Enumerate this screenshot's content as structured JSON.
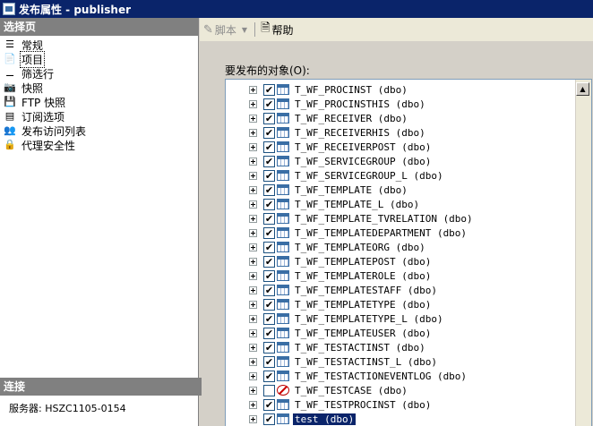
{
  "window": {
    "title": "发布属性 - publisher"
  },
  "left_pane": {
    "header": "选择页",
    "items": [
      {
        "label": "常规",
        "icon": "general-icon",
        "selected": false
      },
      {
        "label": "项目",
        "icon": "articles-icon",
        "selected": true
      },
      {
        "label": "筛选行",
        "icon": "filter-rows-icon",
        "selected": false
      },
      {
        "label": "快照",
        "icon": "snapshot-icon",
        "selected": false
      },
      {
        "label": "FTP 快照",
        "icon": "ftp-snapshot-icon",
        "selected": false
      },
      {
        "label": "订阅选项",
        "icon": "subscription-options-icon",
        "selected": false
      },
      {
        "label": "发布访问列表",
        "icon": "access-list-icon",
        "selected": false
      },
      {
        "label": "代理安全性",
        "icon": "agent-security-icon",
        "selected": false
      }
    ],
    "connection_header": "连接",
    "server_label": "服务器:",
    "server_value": "HSZC1105-0154"
  },
  "toolbar": {
    "script_label": "脚本",
    "help_label": "帮助"
  },
  "objects": {
    "label": "要发布的对象(O):",
    "rows": [
      {
        "name": "T_WF_PROCINST (dbo)",
        "checked": true,
        "blocked": false
      },
      {
        "name": "T_WF_PROCINSTHIS (dbo)",
        "checked": true,
        "blocked": false
      },
      {
        "name": "T_WF_RECEIVER (dbo)",
        "checked": true,
        "blocked": false
      },
      {
        "name": "T_WF_RECEIVERHIS (dbo)",
        "checked": true,
        "blocked": false
      },
      {
        "name": "T_WF_RECEIVERPOST (dbo)",
        "checked": true,
        "blocked": false
      },
      {
        "name": "T_WF_SERVICEGROUP (dbo)",
        "checked": true,
        "blocked": false
      },
      {
        "name": "T_WF_SERVICEGROUP_L (dbo)",
        "checked": true,
        "blocked": false
      },
      {
        "name": "T_WF_TEMPLATE (dbo)",
        "checked": true,
        "blocked": false
      },
      {
        "name": "T_WF_TEMPLATE_L (dbo)",
        "checked": true,
        "blocked": false
      },
      {
        "name": "T_WF_TEMPLATE_TVRELATION (dbo)",
        "checked": true,
        "blocked": false
      },
      {
        "name": "T_WF_TEMPLATEDEPARTMENT (dbo)",
        "checked": true,
        "blocked": false
      },
      {
        "name": "T_WF_TEMPLATEORG (dbo)",
        "checked": true,
        "blocked": false
      },
      {
        "name": "T_WF_TEMPLATEPOST (dbo)",
        "checked": true,
        "blocked": false
      },
      {
        "name": "T_WF_TEMPLATEROLE (dbo)",
        "checked": true,
        "blocked": false
      },
      {
        "name": "T_WF_TEMPLATESTAFF (dbo)",
        "checked": true,
        "blocked": false
      },
      {
        "name": "T_WF_TEMPLATETYPE (dbo)",
        "checked": true,
        "blocked": false
      },
      {
        "name": "T_WF_TEMPLATETYPE_L (dbo)",
        "checked": true,
        "blocked": false
      },
      {
        "name": "T_WF_TEMPLATEUSER (dbo)",
        "checked": true,
        "blocked": false
      },
      {
        "name": "T_WF_TESTACTINST (dbo)",
        "checked": true,
        "blocked": false
      },
      {
        "name": "T_WF_TESTACTINST_L (dbo)",
        "checked": true,
        "blocked": false
      },
      {
        "name": "T_WF_TESTACTIONEVENTLOG (dbo)",
        "checked": true,
        "blocked": false
      },
      {
        "name": "T_WF_TESTCASE (dbo)",
        "checked": false,
        "blocked": true
      },
      {
        "name": "T_WF_TESTPROCINST (dbo)",
        "checked": true,
        "blocked": false
      },
      {
        "name": "test (dbo)",
        "checked": true,
        "blocked": false,
        "selected": true
      }
    ]
  }
}
